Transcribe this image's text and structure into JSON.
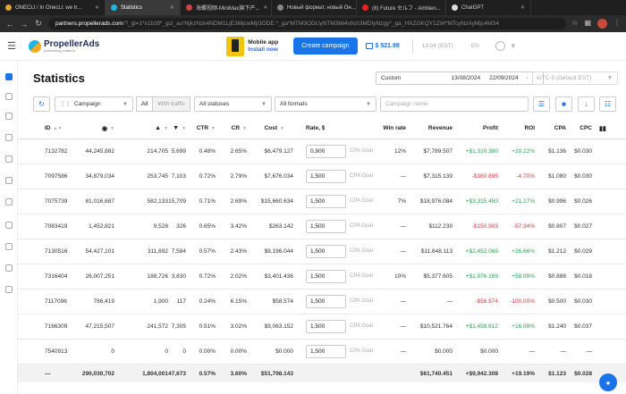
{
  "browser": {
    "tabs": [
      {
        "label": "ONECLI / In OnecLi: we tr...",
        "active": false,
        "color": "#e0a23a"
      },
      {
        "label": "Statistics",
        "active": true,
        "color": "#1fb6e3"
      },
      {
        "label": "海螺视频-MiniMax旗下产...",
        "active": false,
        "color": "#c44"
      },
      {
        "label": "Новый формат, новый Он...",
        "active": false,
        "color": "#888"
      },
      {
        "label": "(8) Future セルフ - Ambien...",
        "active": false,
        "color": "#e22"
      },
      {
        "label": "ChatGPT",
        "active": false,
        "color": "#ddd"
      }
    ],
    "url_domain": "partners.propellerads.com",
    "url_rest": "/?_gl=1*x1b3fl*_gcl_au*NjkzNzk4NDM1LjE3MjcwMjI3ODE.*_ga*MTM3ODUyNTM3Mi4xNzI3MDIyNzgy*_ga_HXZGKQY1ZW*MTcyNzAyMjc4MS4"
  },
  "header": {
    "logo_name": "PropellerAds",
    "logo_tag": "advertising platform",
    "mobile_title": "Mobile app",
    "mobile_link": "Install now",
    "create_label": "Create campaign",
    "balance": "$ 521.98",
    "clock": "13:04 (EST)",
    "lang": "EN"
  },
  "page": {
    "title": "Statistics",
    "date_mode": "Custom",
    "date_from": "13/08/2024",
    "date_to": "22/09/2024",
    "timezone": "UTC-5 (Default EST)"
  },
  "filters": {
    "group": "Campaign",
    "seg_all": "All",
    "seg_traffic": "With traffic",
    "status": "All statuses",
    "formats": "All formats",
    "name_placeholder": "Campaign name"
  },
  "columns": {
    "id": "ID",
    "ctr": "CTR",
    "cr": "CR",
    "cost": "Cost",
    "rate": "Rate, $",
    "winrate": "Win rate",
    "revenue": "Revenue",
    "profit": "Profit",
    "roi": "ROI",
    "cpa": "CPA",
    "cpc": "CPC"
  },
  "rate_suffix": "CPA Goal",
  "rows": [
    {
      "id": "7132782",
      "impr": "44,245,882",
      "clicks": "214,705",
      "conv": "5,699",
      "ctr": "0.48%",
      "cr": "2.65%",
      "cost": "$6,479.127",
      "rate": "0,900",
      "win": "12%",
      "rev": "$7,789.507",
      "profit": "+$1,310.380",
      "roi": "+20.22%",
      "cpa": "$1.136",
      "cpc": "$0.030",
      "sign": "pos"
    },
    {
      "id": "7097586",
      "impr": "34,879,034",
      "clicks": "253,745",
      "conv": "7,103",
      "ctr": "0.72%",
      "cr": "2.79%",
      "cost": "$7,676.034",
      "rate": "1,500",
      "win": "—",
      "rev": "$7,315.139",
      "profit": "-$360.895",
      "roi": "-4.70%",
      "cpa": "$1.080",
      "cpc": "$0.030",
      "sign": "neg"
    },
    {
      "id": "7075739",
      "impr": "81,016,687",
      "clicks": "582,133",
      "conv": "15,709",
      "ctr": "0.71%",
      "cr": "2.69%",
      "cost": "$15,660.634",
      "rate": "1,500",
      "win": "7%",
      "rev": "$18,976.084",
      "profit": "+$3,315.450",
      "roi": "+21.17%",
      "cpa": "$0.996",
      "cpc": "$0.026",
      "sign": "pos"
    },
    {
      "id": "7083419",
      "impr": "1,452,821",
      "clicks": "9,528",
      "conv": "326",
      "ctr": "0.65%",
      "cr": "3.42%",
      "cost": "$263.142",
      "rate": "1,500",
      "win": "—",
      "rev": "$112.239",
      "profit": "-$150.903",
      "roi": "-57.34%",
      "cpa": "$0.807",
      "cpc": "$0.027",
      "sign": "neg"
    },
    {
      "id": "7130516",
      "impr": "54,427,101",
      "clicks": "311,692",
      "conv": "7,584",
      "cost": "$9,196.044",
      "ctr": "0.57%",
      "cr": "2.43%",
      "rate": "1,500",
      "win": "—",
      "rev": "$11,648.113",
      "profit": "+$2,452.069",
      "roi": "+26.66%",
      "cpa": "$1.212",
      "cpc": "$0.029",
      "sign": "pos"
    },
    {
      "id": "7316404",
      "impr": "26,007,251",
      "clicks": "188,726",
      "conv": "3,830",
      "ctr": "0.72%",
      "cr": "2.02%",
      "cost": "$3,401.436",
      "rate": "1,500",
      "win": "10%",
      "rev": "$5,377.605",
      "profit": "+$1,976.169",
      "roi": "+58.09%",
      "cpa": "$0.888",
      "cpc": "$0.018",
      "sign": "pos"
    },
    {
      "id": "7117096",
      "impr": "786,419",
      "clicks": "1,900",
      "conv": "117",
      "ctr": "0.24%",
      "cr": "6.15%",
      "cost": "$58.574",
      "rate": "1,500",
      "win": "—",
      "rev": "—",
      "profit": "-$58.574",
      "roi": "-100.00%",
      "cpa": "$0.500",
      "cpc": "$0.030",
      "sign": "neg"
    },
    {
      "id": "7166309",
      "impr": "47,215,507",
      "clicks": "241,572",
      "conv": "7,305",
      "ctr": "0.51%",
      "cr": "3.02%",
      "cost": "$9,063.152",
      "rate": "1,500",
      "win": "—",
      "rev": "$10,521.764",
      "profit": "+$1,458.612",
      "roi": "+16.09%",
      "cpa": "$1.240",
      "cpc": "$0.037",
      "sign": "pos"
    },
    {
      "id": "7540913",
      "impr": "0",
      "clicks": "0",
      "conv": "0",
      "ctr": "0.00%",
      "cr": "0.00%",
      "cost": "$0.000",
      "rate": "1,500",
      "win": "—",
      "rev": "$0.000",
      "profit": "$0.000",
      "roi": "—",
      "cpa": "—",
      "cpc": "—",
      "sign": "none"
    }
  ],
  "totals": {
    "id": "—",
    "impr": "290,030,702",
    "clicks": "1,804,001",
    "conv": "47,673",
    "ctr": "0.57%",
    "cr": "3.60%",
    "cost": "$51,798.143",
    "rev": "$61,740.451",
    "profit": "+$9,942.308",
    "roi": "+19.19%",
    "cpa": "$1.123",
    "cpc": "$0.028"
  },
  "colors": {
    "accent": "#1a73e8",
    "positive": "#2e9e4f",
    "negative": "#d63b3b"
  }
}
